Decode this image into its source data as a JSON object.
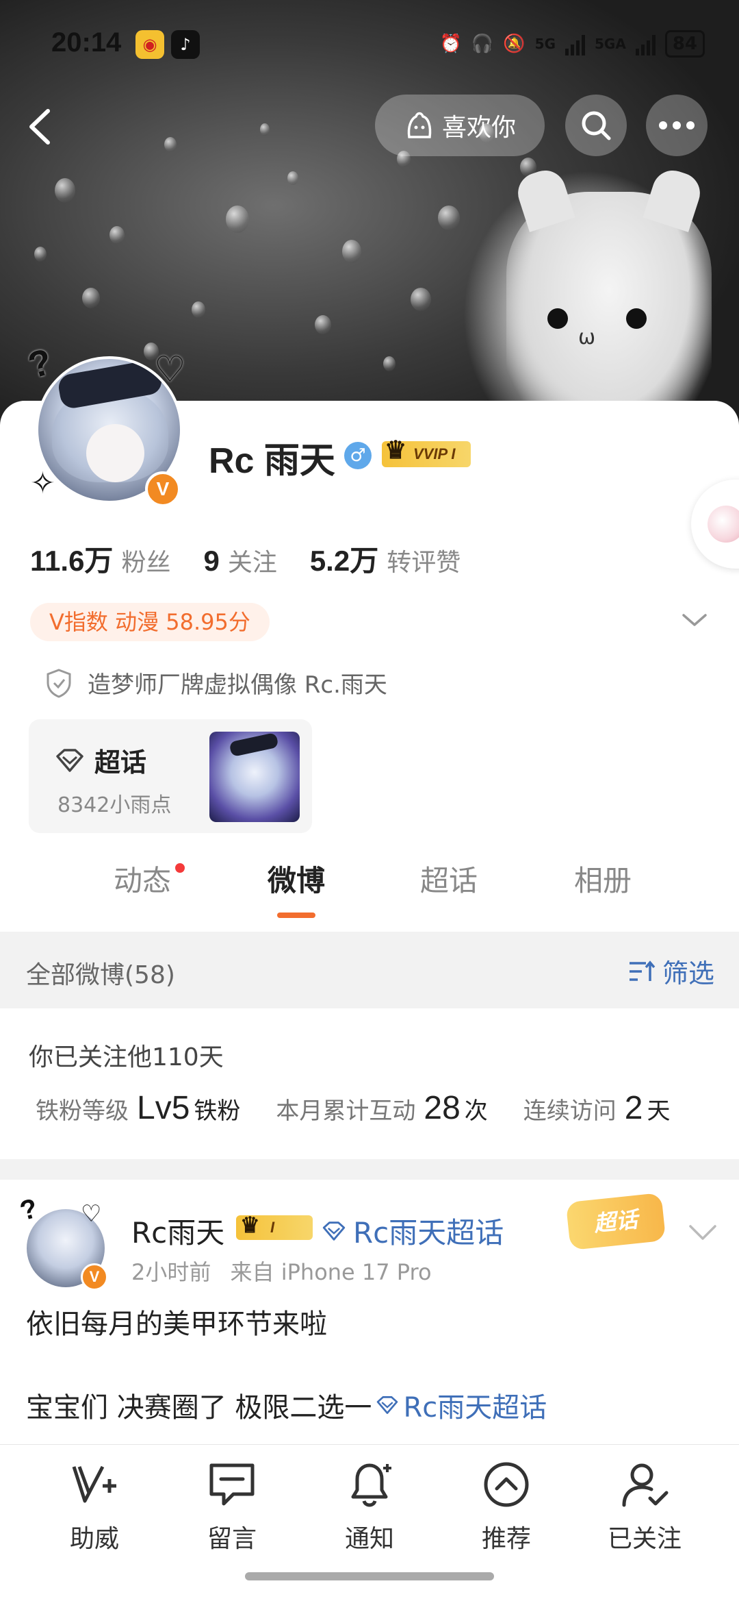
{
  "status_bar": {
    "time": "20:14",
    "battery": "84",
    "network1": "5G",
    "network2": "5GA"
  },
  "top_nav": {
    "like_label": "喜欢你"
  },
  "profile": {
    "name": "Rc 雨天",
    "vvip_label": "VVIP I",
    "stats": [
      {
        "num": "11.6万",
        "label": "粉丝"
      },
      {
        "num": "9",
        "label": "关注"
      },
      {
        "num": "5.2万",
        "label": "转评赞"
      }
    ],
    "v_index": "V指数 动漫 58.95分",
    "certification": "造梦师厂牌虚拟偶像 Rc.雨天",
    "super_topic": {
      "title": "超话",
      "sub": "8342小雨点"
    }
  },
  "tabs": [
    {
      "label": "动态"
    },
    {
      "label": "微博"
    },
    {
      "label": "超话"
    },
    {
      "label": "相册"
    }
  ],
  "feed_header": {
    "count_label": "全部微博(58)",
    "filter_label": "筛选"
  },
  "fan_info": {
    "since": "你已关注他110天",
    "level_label": "铁粉等级",
    "level_value": "Lv5",
    "level_suffix": "铁粉",
    "interact_label": "本月累计互动",
    "interact_value": "28",
    "interact_unit": "次",
    "visit_label": "连续访问",
    "visit_value": "2",
    "visit_unit": "天"
  },
  "post": {
    "name": "Rc雨天",
    "badge": "I",
    "topic": "Rc雨天超话",
    "sticker": "超话",
    "time": "2小时前",
    "source": "来自 iPhone 17 Pro",
    "line1": "依旧每月的美甲环节来啦",
    "line2": "宝宝们 决赛圈了 极限二选一",
    "line2_topic": "Rc雨天超话"
  },
  "bottom_bar": [
    {
      "label": "助威",
      "icon": "cheer-icon"
    },
    {
      "label": "留言",
      "icon": "message-icon"
    },
    {
      "label": "通知",
      "icon": "bell-icon"
    },
    {
      "label": "推荐",
      "icon": "recommend-icon"
    },
    {
      "label": "已关注",
      "icon": "followed-icon"
    }
  ]
}
